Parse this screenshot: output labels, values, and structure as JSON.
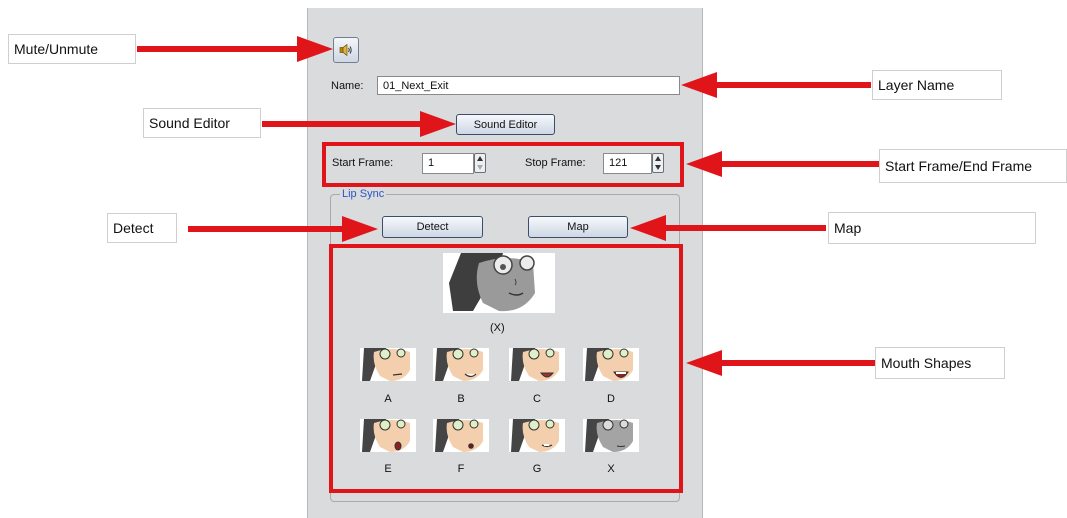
{
  "callouts": {
    "mute": "Mute/Unmute",
    "layer_name": "Layer Name",
    "sound_editor": "Sound Editor",
    "frames": "Start Frame/End Frame",
    "detect": "Detect",
    "map": "Map",
    "mouth_shapes": "Mouth Shapes"
  },
  "panel": {
    "name_label": "Name:",
    "name_value": "01_Next_Exit",
    "sound_editor_button": "Sound Editor",
    "start_frame_label": "Start Frame:",
    "start_frame_value": "1",
    "stop_frame_label": "Stop Frame:",
    "stop_frame_value": "121",
    "lip_sync_title": "Lip Sync",
    "detect_button": "Detect",
    "map_button": "Map",
    "current_shape_label": "(X)",
    "mouth_shapes": [
      {
        "label": "A",
        "mouth": "A"
      },
      {
        "label": "B",
        "mouth": "B"
      },
      {
        "label": "C",
        "mouth": "C"
      },
      {
        "label": "D",
        "mouth": "D"
      },
      {
        "label": "E",
        "mouth": "E"
      },
      {
        "label": "F",
        "mouth": "F"
      },
      {
        "label": "G",
        "mouth": "G"
      },
      {
        "label": "X",
        "mouth": "X"
      }
    ]
  },
  "colors": {
    "annotation_red": "#e0151a",
    "panel_bg": "#dadbdd",
    "group_title_blue": "#2a55c8",
    "skin": "#f3cfae",
    "hair": "#454545"
  }
}
